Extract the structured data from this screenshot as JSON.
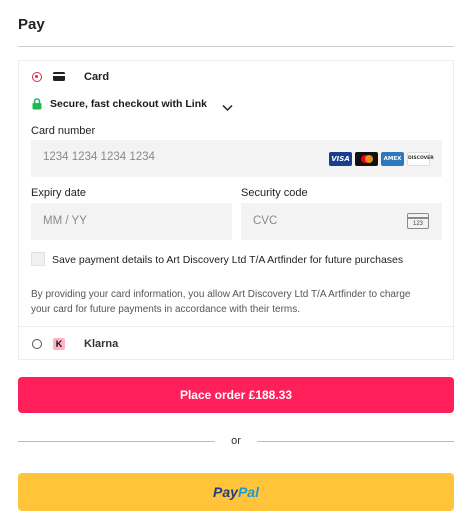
{
  "header": {
    "title": "Pay"
  },
  "card_option": {
    "label": "Card",
    "selected": true,
    "link_text": "Secure, fast checkout with Link",
    "card_number": {
      "label": "Card number",
      "placeholder": "1234 1234 1234 1234"
    },
    "brands": [
      "VISA",
      "MC",
      "AMEX",
      "DISCOVER"
    ],
    "expiry": {
      "label": "Expiry date",
      "placeholder": "MM / YY"
    },
    "security": {
      "label": "Security code",
      "placeholder": "CVC",
      "icon_text": "123"
    },
    "save_label": "Save payment details to Art Discovery Ltd T/A Artfinder for future purchases",
    "disclaimer": "By providing your card information, you allow Art Discovery Ltd T/A Artfinder to charge your card for future payments in accordance with their terms."
  },
  "klarna_option": {
    "label": "Klarna",
    "icon_letter": "K",
    "selected": false
  },
  "place_order": {
    "label": "Place order £188.33"
  },
  "divider": {
    "text": "or"
  },
  "paypal": {
    "label_pay": "Pay",
    "label_pal": "Pal"
  },
  "colors": {
    "accent": "#ff1f5a",
    "paypal_bg": "#ffc43a",
    "link_green": "#1db954",
    "klarna_pink": "#ffb3c7"
  }
}
